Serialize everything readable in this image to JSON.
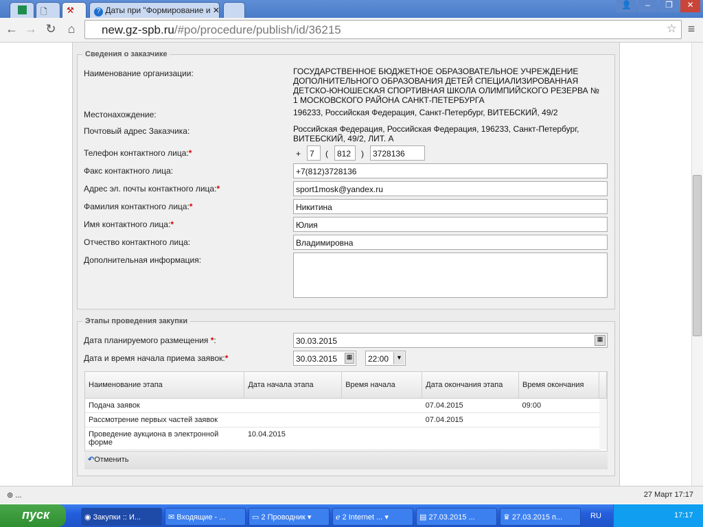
{
  "browser": {
    "tab_title": "Даты при \"Формирование и",
    "url_host": "new.gz-spb.ru",
    "url_path": "/#po/procedure/publish/id/36215"
  },
  "customer": {
    "legend": "Сведения о заказчике",
    "org_label": "Наименование организации:",
    "org_value": "ГОСУДАРСТВЕННОЕ БЮДЖЕТНОЕ ОБРАЗОВАТЕЛЬНОЕ УЧРЕЖДЕНИЕ ДОПОЛНИТЕЛЬНОГО ОБРАЗОВАНИЯ ДЕТЕЙ СПЕЦИАЛИЗИРОВАННАЯ ДЕТСКО-ЮНОШЕСКАЯ СПОРТИВНАЯ ШКОЛА ОЛИМПИЙСКОГО РЕЗЕРВА № 1 МОСКОВСКОГО РАЙОНА САНКТ-ПЕТЕРБУРГА",
    "location_label": "Местонахождение:",
    "location_value": "196233, Российская Федерация, Санкт-Петербург, ВИТЕБСКИЙ, 49/2",
    "postal_label": "Почтовый адрес Заказчика:",
    "postal_value": "Российская Федерация, Российская Федерация, 196233, Санкт-Петербург, ВИТЕБСКИЙ, 49/2, ЛИТ. А",
    "phone_label": "Телефон контактного лица:",
    "phone_plus": "+",
    "phone_country": "7",
    "phone_open": "(",
    "phone_code": "812",
    "phone_close": ")",
    "phone_number": "3728136",
    "fax_label": "Факс контактного лица:",
    "fax_value": "+7(812)3728136",
    "email_label": "Адрес эл. почты контактного лица:",
    "email_value": "sport1mosk@yandex.ru",
    "lastname_label": "Фамилия контактного лица:",
    "lastname_value": "Никитина",
    "firstname_label": "Имя контактного лица:",
    "firstname_value": "Юлия",
    "middlename_label": "Отчество контактного лица:",
    "middlename_value": "Владимировна",
    "extra_label": "Дополнительная информация:",
    "extra_value": "",
    "required_mark": "*"
  },
  "stages": {
    "legend": "Этапы проведения закупки",
    "planned_label": "Дата планируемого размещения ",
    "planned_colon": ":",
    "planned_value": "30.03.2015",
    "start_label": "Дата и время начала приема заявок:",
    "start_date": "30.03.2015",
    "start_time": "22:00",
    "columns": [
      "Наименование этапа",
      "Дата начала этапа",
      "Время начала",
      "Дата окончания этапа",
      "Время окончания"
    ],
    "rows": [
      [
        "Подача заявок",
        "",
        "",
        "07.04.2015",
        "09:00"
      ],
      [
        "Рассмотрение первых частей заявок",
        "",
        "",
        "07.04.2015",
        ""
      ],
      [
        "Проведение аукциона в электронной форме",
        "10.04.2015",
        "",
        "",
        ""
      ]
    ],
    "cancel_label": "Отменить"
  },
  "status": {
    "left": "...",
    "right": "27 Март 17:17"
  },
  "taskbar": {
    "start": "пуск",
    "items": [
      "Закупки :: И...",
      "Входящие - ...",
      "2 Проводник",
      "2 Internet ...",
      "27.03.2015 ...",
      "27.03.2015 п..."
    ],
    "lang": "RU",
    "clock": "17:17"
  }
}
